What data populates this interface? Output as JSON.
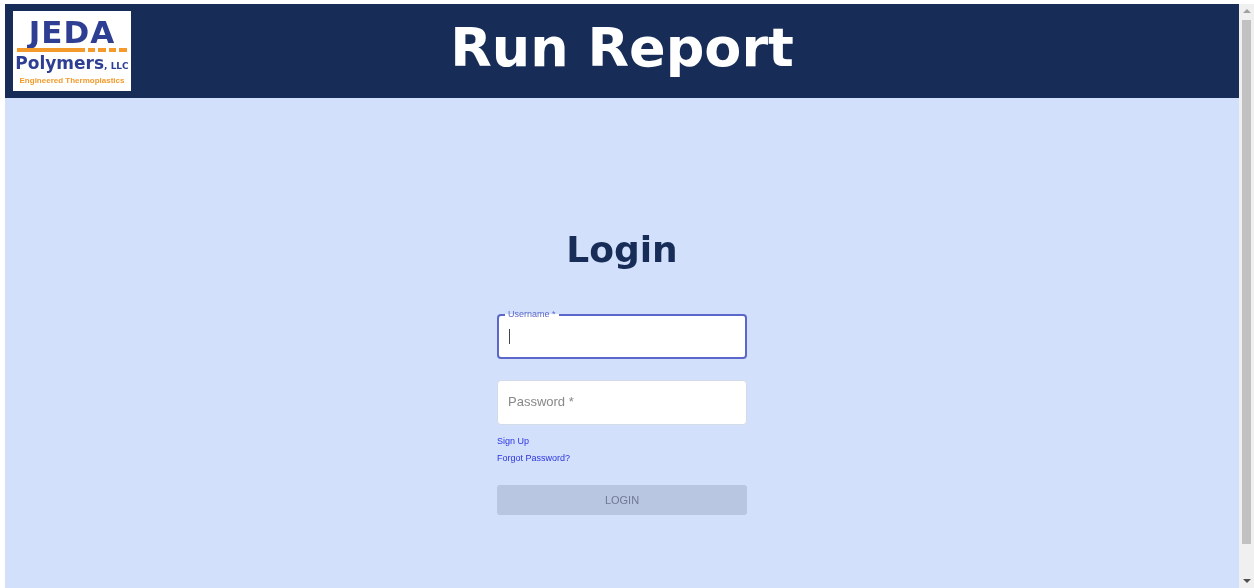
{
  "header": {
    "logo": {
      "name": "JEDA",
      "line_2": "Polymers",
      "suffix": ", LLC",
      "tagline": "Engineered Thermoplastics"
    },
    "title": "Run Report"
  },
  "login": {
    "heading": "Login",
    "fields": [
      {
        "label": "Username *",
        "focused": true
      },
      {
        "label": "Password *",
        "focused": false
      }
    ],
    "links": [
      "Sign Up",
      "Forgot Password?"
    ],
    "button": {
      "label": "LOGIN",
      "disabled": true
    }
  }
}
